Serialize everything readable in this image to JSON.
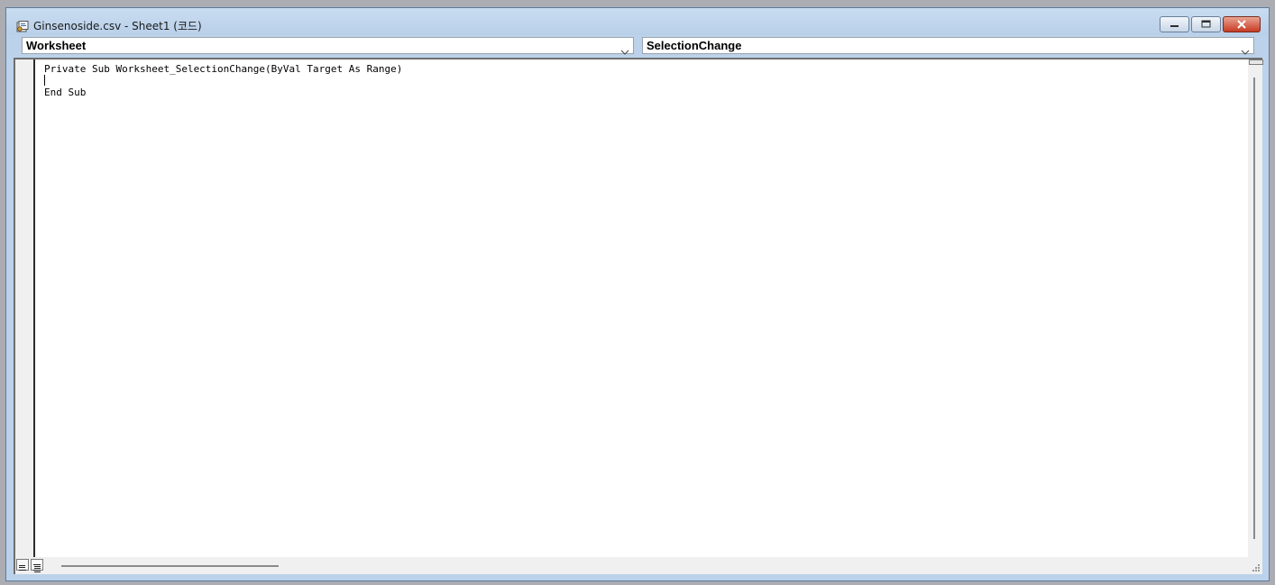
{
  "window": {
    "title": "Ginsenoside.csv - Sheet1 (코드)",
    "icon": "vba-module-icon",
    "buttons": {
      "minimize": "minimize-icon",
      "maximize": "restore-icon",
      "close": "close-icon"
    }
  },
  "object_box": {
    "selected": "Worksheet"
  },
  "procedure_box": {
    "selected": "SelectionChange"
  },
  "code": {
    "lines": [
      "Private Sub Worksheet_SelectionChange(ByVal Target As Range)",
      "",
      "End Sub"
    ],
    "caret_line": 2
  },
  "view_buttons": {
    "procedure_view": "procedure-view-icon",
    "full_module_view": "full-module-view-icon"
  },
  "colors": {
    "titlebar": "#bcd2ea",
    "editor_background": "#ffffff",
    "close_button": "#c63b23"
  }
}
